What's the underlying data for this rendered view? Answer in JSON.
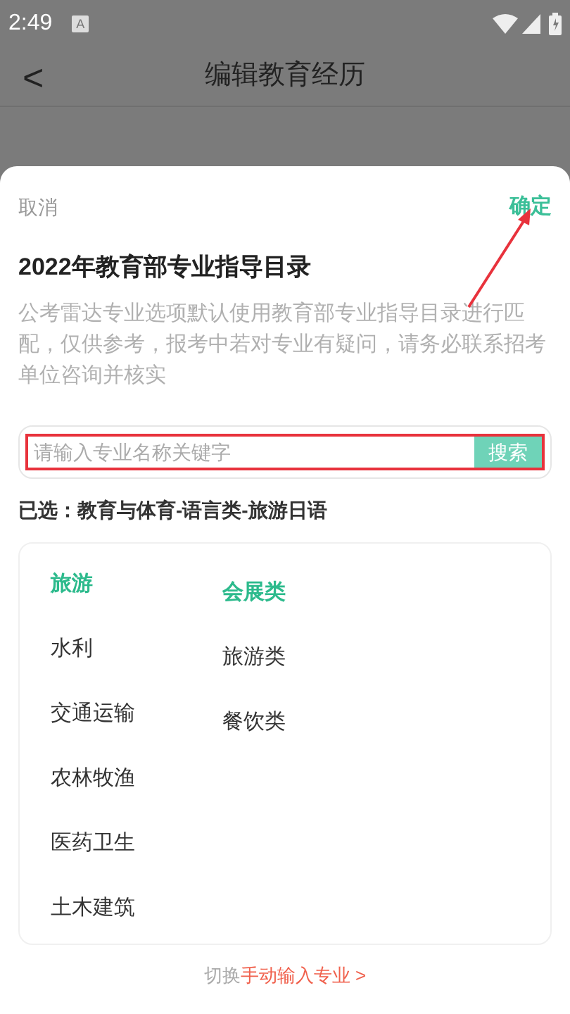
{
  "status_bar": {
    "time": "2:49",
    "notification": "A"
  },
  "header": {
    "back": "<",
    "title": "编辑教育经历"
  },
  "sheet": {
    "cancel": "取消",
    "confirm": "确定",
    "title": "2022年教育部专业指导目录",
    "notice": "公考雷达专业选项默认使用教育部专业指导目录进行匹配，仅供参考，报考中若对专业有疑问，请务必联系招考单位咨询并核实",
    "search": {
      "placeholder": "请输入专业名称关键字",
      "button": "搜索"
    },
    "selected_path": "已选：教育与体育-语言类-旅游日语",
    "columns": [
      [
        {
          "label": "旅游",
          "selected": true
        },
        {
          "label": "水利",
          "selected": false
        },
        {
          "label": "交通运输",
          "selected": false
        },
        {
          "label": "农林牧渔",
          "selected": false
        },
        {
          "label": "医药卫生",
          "selected": false
        },
        {
          "label": "土木建筑",
          "selected": false
        }
      ],
      [
        {
          "label": "会展类",
          "selected": true
        },
        {
          "label": "旅游类",
          "selected": false
        },
        {
          "label": "餐饮类",
          "selected": false
        }
      ]
    ],
    "footer": {
      "prefix": "切换",
      "link": "手动输入专业 >"
    }
  }
}
